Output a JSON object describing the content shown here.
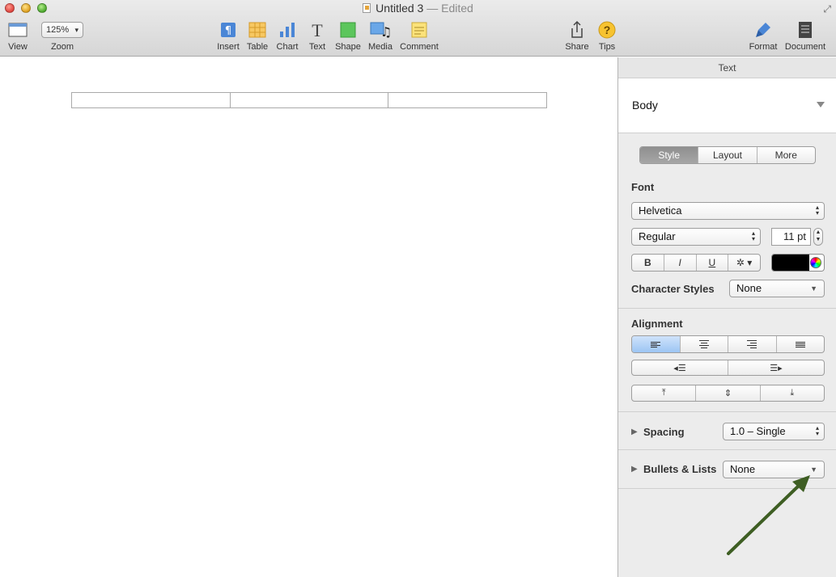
{
  "window": {
    "title": "Untitled 3",
    "edited_suffix": "— Edited"
  },
  "toolbar": {
    "view_label": "View",
    "zoom_value": "125%",
    "zoom_label": "Zoom",
    "insert_label": "Insert",
    "table_label": "Table",
    "chart_label": "Chart",
    "text_label": "Text",
    "shape_label": "Shape",
    "media_label": "Media",
    "comment_label": "Comment",
    "share_label": "Share",
    "tips_label": "Tips",
    "format_label": "Format",
    "document_label": "Document"
  },
  "inspector": {
    "header": "Text",
    "paragraph_style": "Body",
    "tabs": [
      "Style",
      "Layout",
      "More"
    ],
    "font_section": "Font",
    "font_family": "Helvetica",
    "font_typeface": "Regular",
    "font_size": "11 pt",
    "bold_label": "B",
    "italic_label": "I",
    "underline_label": "U",
    "text_color": "#000000",
    "character_styles_label": "Character Styles",
    "character_styles_value": "None",
    "alignment_section": "Alignment",
    "spacing_label": "Spacing",
    "spacing_value": "1.0 – Single",
    "bullets_label": "Bullets & Lists",
    "bullets_value": "None"
  },
  "annotation": {
    "arrow_color": "#3e5e23"
  }
}
